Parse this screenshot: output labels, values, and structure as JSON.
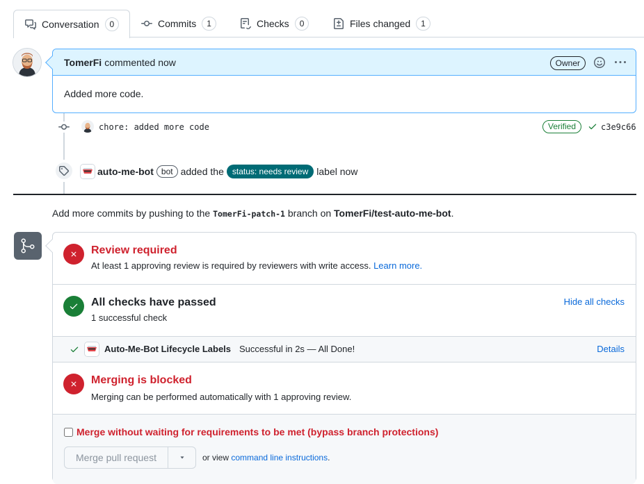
{
  "tabs": [
    {
      "label": "Conversation",
      "count": "0",
      "icon": "comment-discussion-icon"
    },
    {
      "label": "Commits",
      "count": "1",
      "icon": "git-commit-icon"
    },
    {
      "label": "Checks",
      "count": "0",
      "icon": "checklist-icon"
    },
    {
      "label": "Files changed",
      "count": "1",
      "icon": "file-diff-icon"
    }
  ],
  "comment": {
    "author": "TomerFi",
    "meta": "commented now",
    "role_badge": "Owner",
    "body": "Added more code."
  },
  "commit": {
    "message": "chore: added more code",
    "verified": "Verified",
    "sha": "c3e9c66"
  },
  "label_event": {
    "actor": "auto-me-bot",
    "bot_badge": "bot",
    "action": "added the",
    "label": "status: needs review",
    "suffix": "label now",
    "label_color": "#006b75"
  },
  "push_hint": {
    "prefix": "Add more commits by pushing to the",
    "branch": "TomerFi-patch-1",
    "middle": "branch on",
    "repo": "TomerFi/test-auto-me-bot"
  },
  "review": {
    "title": "Review required",
    "subtitle": "At least 1 approving review is required by reviewers with write access.",
    "link": "Learn more."
  },
  "checks": {
    "title": "All checks have passed",
    "subtitle": "1 successful check",
    "toggle": "Hide all checks",
    "items": [
      {
        "name": "Auto-Me-Bot Lifecycle Labels",
        "status": "Successful in 2s — All Done!",
        "details": "Details"
      }
    ]
  },
  "merge_status": {
    "title": "Merging is blocked",
    "subtitle": "Merging can be performed automatically with 1 approving review."
  },
  "bypass": {
    "label": "Merge without waiting for requirements to be met (bypass branch protections)",
    "checked": false
  },
  "merge_actions": {
    "button": "Merge pull request",
    "or_view": "or view",
    "cli_link": "command line instructions",
    "cli_period": "."
  },
  "colors": {
    "danger": "#cf222e",
    "success": "#1a7f37",
    "accent": "#0969da",
    "comment_header": "#ddf4ff"
  }
}
